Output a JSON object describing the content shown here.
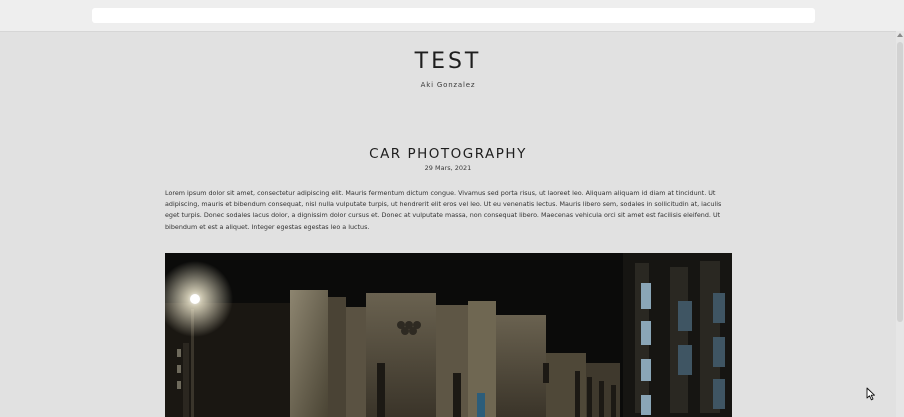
{
  "site": {
    "title": "TEST",
    "author": "Aki Gonzalez"
  },
  "post": {
    "title": "CAR PHOTOGRAPHY",
    "date": "29 Mars, 2021",
    "body": "Lorem ipsum dolor sit amet, consectetur adipiscing elit. Mauris fermentum dictum congue. Vivamus sed porta risus, ut laoreet leo. Aliquam aliquam id diam at tincidunt. Ut adipiscing, mauris et bibendum consequat, nisl nulla vulputate turpis, ut hendrerit elit eros vel leo. Ut eu venenatis lectus. Mauris libero sem, sodales in sollicitudin at, iaculis eget turpis. Donec sodales lacus dolor, a dignissim dolor cursus et. Donec at vulputate massa, non consequat libero. Maecenas vehicula orci sit amet est facilisis eleifend. Ut bibendum et est a aliquet. Integer egestas egestas leo a luctus.",
    "image_icon": "night-building-photo"
  },
  "colors": {
    "page_background": "#e1e1e1",
    "text": "#1e1e1e",
    "photo_background": "#0b0b0a"
  }
}
